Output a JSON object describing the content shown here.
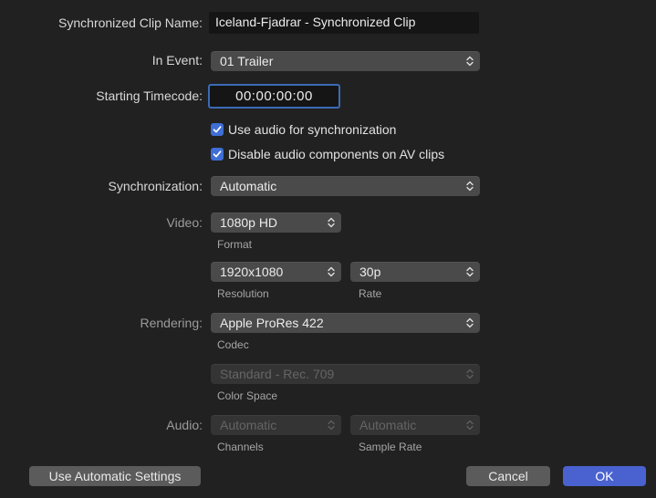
{
  "clip_name": {
    "label": "Synchronized Clip Name:",
    "value": "Iceland-Fjadrar - Synchronized Clip"
  },
  "in_event": {
    "label": "In Event:",
    "value": "01 Trailer"
  },
  "starting_timecode": {
    "label": "Starting Timecode:",
    "value": "00:00:00:00"
  },
  "options": {
    "use_audio_sync": {
      "label": "Use audio for synchronization",
      "checked": true
    },
    "disable_audio_components": {
      "label": "Disable audio components on AV clips",
      "checked": true
    }
  },
  "synchronization": {
    "label": "Synchronization:",
    "value": "Automatic"
  },
  "video": {
    "label": "Video:",
    "format": {
      "value": "1080p HD",
      "caption": "Format"
    },
    "resolution": {
      "value": "1920x1080",
      "caption": "Resolution"
    },
    "rate": {
      "value": "30p",
      "caption": "Rate"
    }
  },
  "rendering": {
    "label": "Rendering:",
    "codec": {
      "value": "Apple ProRes 422",
      "caption": "Codec"
    },
    "color_space": {
      "value": "Standard - Rec. 709",
      "caption": "Color Space",
      "enabled": false
    }
  },
  "audio": {
    "label": "Audio:",
    "channels": {
      "value": "Automatic",
      "caption": "Channels",
      "enabled": false
    },
    "sample_rate": {
      "value": "Automatic",
      "caption": "Sample Rate",
      "enabled": false
    }
  },
  "buttons": {
    "use_automatic": "Use Automatic Settings",
    "cancel": "Cancel",
    "ok": "OK"
  },
  "colors": {
    "background": "#212121",
    "accent": "#4a62cf",
    "checkbox": "#3e6ed6",
    "focus_ring": "#3a6bb6"
  }
}
